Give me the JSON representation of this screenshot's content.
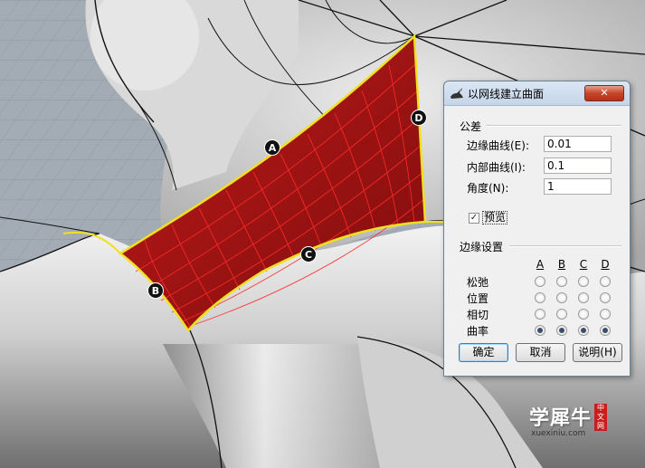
{
  "viewport": {
    "markers": [
      {
        "id": "a",
        "label": "A"
      },
      {
        "id": "b",
        "label": "B"
      },
      {
        "id": "c",
        "label": "C"
      },
      {
        "id": "d",
        "label": "D"
      }
    ],
    "colors": {
      "surface_fill": "#9d1414",
      "edge_highlight": "#f0e020",
      "mesh": "#ff2a2a"
    }
  },
  "dialog": {
    "title": "以网线建立曲面",
    "icon": "rhino-icon",
    "close_label": "✕",
    "tolerance": {
      "group_label": "公差",
      "edge_curves": {
        "label": "边缘曲线(E):",
        "value": "0.01"
      },
      "inner_curves": {
        "label": "内部曲线(I):",
        "value": "0.1"
      },
      "angle": {
        "label": "角度(N):",
        "value": "1"
      }
    },
    "preview": {
      "label": "预览",
      "checked": true,
      "check_mark": "✓"
    },
    "edge_settings": {
      "group_label": "边缘设置",
      "columns": [
        "A",
        "B",
        "C",
        "D"
      ],
      "rows": [
        "松弛",
        "位置",
        "相切",
        "曲率"
      ],
      "selected_row": "曲率"
    },
    "buttons": {
      "ok": "确定",
      "cancel": "取消",
      "help": "说明(H)"
    }
  },
  "watermark": {
    "main": "学犀牛",
    "badge": "中文网",
    "url": "xuexiniu.com"
  }
}
